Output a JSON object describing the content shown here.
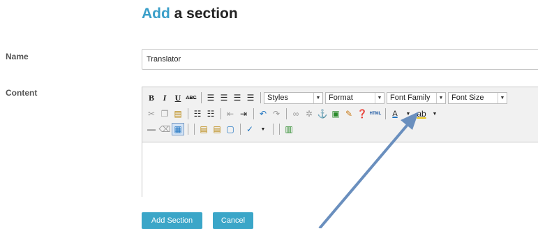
{
  "page": {
    "title_accent": "Add",
    "title_rest": "a section"
  },
  "form": {
    "name_label": "Name",
    "name_value": "Translator",
    "content_label": "Content"
  },
  "toolbar": {
    "row1": {
      "bold": "B",
      "italic": "I",
      "underline": "U",
      "strike": "ABC",
      "styles": "Styles",
      "format": "Format",
      "font_family": "Font Family",
      "font_size": "Font Size"
    },
    "row2": {
      "html": "HTML",
      "text_color": "A"
    }
  },
  "buttons": {
    "add_section": "Add Section",
    "cancel": "Cancel"
  },
  "colors": {
    "accent": "#3a9fc9",
    "button": "#3ba6c8",
    "arrow": "#6a8fbe"
  }
}
